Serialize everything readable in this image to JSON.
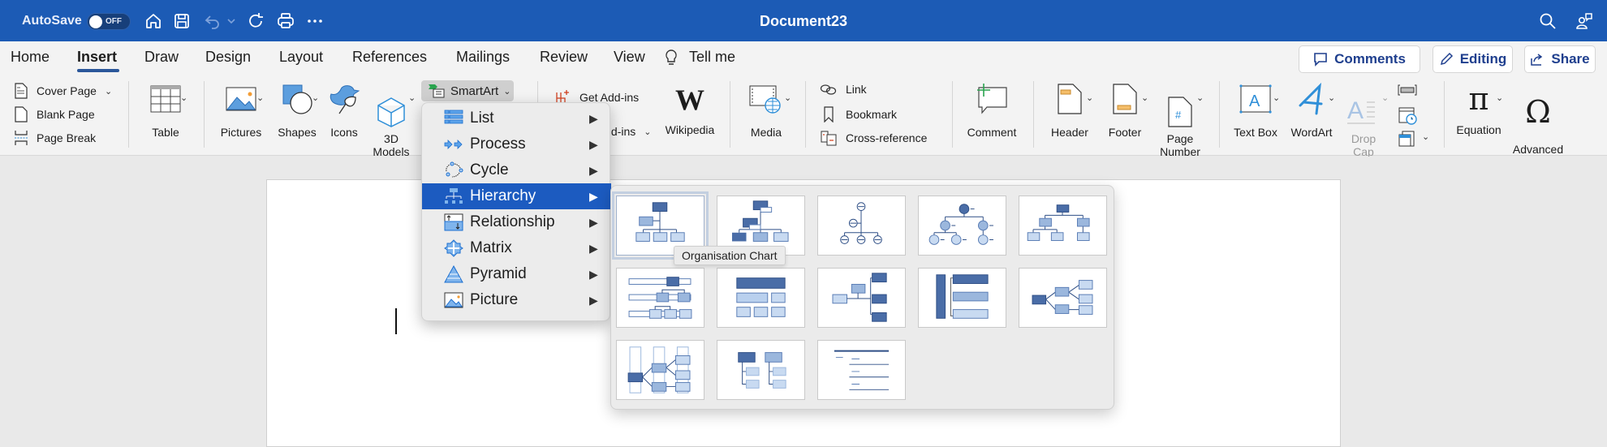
{
  "titlebar": {
    "autosave_label": "AutoSave",
    "autosave_state": "OFF",
    "document_title": "Document23",
    "icons": [
      "home-icon",
      "save-icon",
      "undo-icon",
      "undo-dropdown-icon",
      "redo-icon",
      "print-icon",
      "more-icon",
      "search-icon",
      "collaborate-icon"
    ]
  },
  "tabs": {
    "items": [
      "Home",
      "Insert",
      "Draw",
      "Design",
      "Layout",
      "References",
      "Mailings",
      "Review",
      "View"
    ],
    "active": "Insert",
    "tell_me": "Tell me",
    "comments_label": "Comments",
    "editing_label": "Editing",
    "share_label": "Share"
  },
  "ribbon": {
    "pages": {
      "cover_page": "Cover Page",
      "blank_page": "Blank Page",
      "page_break": "Page Break"
    },
    "table": "Table",
    "pictures": "Pictures",
    "shapes": "Shapes",
    "icons": "Icons",
    "models_3d": "3D\nModels",
    "smartart": "SmartArt",
    "get_addins": "Get Add-ins",
    "my_addins": "My Add-ins",
    "wikipedia": "Wikipedia",
    "media": "Media",
    "link": "Link",
    "bookmark": "Bookmark",
    "cross_reference": "Cross-reference",
    "comment": "Comment",
    "header": "Header",
    "footer": "Footer",
    "page_number": "Page\nNumber",
    "text_box": "Text Box",
    "wordart": "WordArt",
    "drop_cap": "Drop\nCap",
    "equation": "Equation",
    "advanced_symbol": "Advanced\nSymbol"
  },
  "smartart_menu": {
    "items": [
      {
        "label": "List",
        "icon": "list-icon"
      },
      {
        "label": "Process",
        "icon": "process-icon"
      },
      {
        "label": "Cycle",
        "icon": "cycle-icon"
      },
      {
        "label": "Hierarchy",
        "icon": "hierarchy-icon",
        "selected": true
      },
      {
        "label": "Relationship",
        "icon": "relationship-icon"
      },
      {
        "label": "Matrix",
        "icon": "matrix-icon"
      },
      {
        "label": "Pyramid",
        "icon": "pyramid-icon"
      },
      {
        "label": "Picture",
        "icon": "picture-icon"
      }
    ]
  },
  "hierarchy_gallery": {
    "selected_index": 0,
    "tooltip": "Organisation Chart",
    "layouts": [
      "organisation-chart",
      "name-and-title-org-chart",
      "half-circle-org-chart",
      "circle-picture-hierarchy",
      "hierarchy",
      "labelled-hierarchy",
      "table-hierarchy",
      "horizontal-org-chart",
      "architecture-layout",
      "horizontal-hierarchy",
      "horizontal-multi-level-hierarchy",
      "hierarchy-list",
      "lined-list"
    ]
  },
  "colors": {
    "title_bar": "#1c5bb5",
    "accent_text": "#1f3f8e",
    "menu_selected": "#1c5bc0",
    "smart_dark": "#4a6da7",
    "smart_light": "#b9d0ee"
  }
}
